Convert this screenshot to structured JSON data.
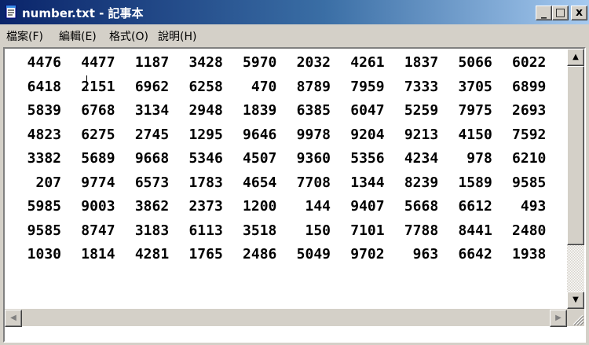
{
  "window": {
    "title": "number.txt - 記事本",
    "icon": "notepad-icon",
    "minimize_label": "_",
    "maximize_label": "□",
    "close_label": "x",
    "title_gradient_start": "#0a246a",
    "title_gradient_end": "#a6caf0"
  },
  "menu": {
    "file": "檔案(F)",
    "edit": "編輯(E)",
    "format": "格式(O)",
    "help": "說明(H)"
  },
  "scrollbar": {
    "up_glyph": "▲",
    "down_glyph": "▼",
    "left_glyph": "◀",
    "right_glyph": "▶"
  },
  "content": {
    "rows": [
      [
        "4476",
        "4477",
        "1187",
        "3428",
        "5970",
        "2032",
        "4261",
        "1837",
        "5066",
        "6022"
      ],
      [
        "6418",
        "2151",
        "6962",
        "6258",
        "470",
        "8789",
        "7959",
        "7333",
        "3705",
        "6899"
      ],
      [
        "5839",
        "6768",
        "3134",
        "2948",
        "1839",
        "6385",
        "6047",
        "5259",
        "7975",
        "2693"
      ],
      [
        "4823",
        "6275",
        "2745",
        "1295",
        "9646",
        "9978",
        "9204",
        "9213",
        "4150",
        "7592"
      ],
      [
        "3382",
        "5689",
        "9668",
        "5346",
        "4507",
        "9360",
        "5356",
        "4234",
        "978",
        "6210"
      ],
      [
        "207",
        "9774",
        "6573",
        "1783",
        "4654",
        "7708",
        "1344",
        "8239",
        "1589",
        "9585"
      ],
      [
        "5985",
        "9003",
        "3862",
        "2373",
        "1200",
        "144",
        "9407",
        "5668",
        "6612",
        "493"
      ],
      [
        "9585",
        "8747",
        "3183",
        "6113",
        "3518",
        "150",
        "7101",
        "7788",
        "8441",
        "2480"
      ],
      [
        "1030",
        "1814",
        "4281",
        "1765",
        "2486",
        "5049",
        "9702",
        "963",
        "6642",
        "1938"
      ]
    ]
  }
}
